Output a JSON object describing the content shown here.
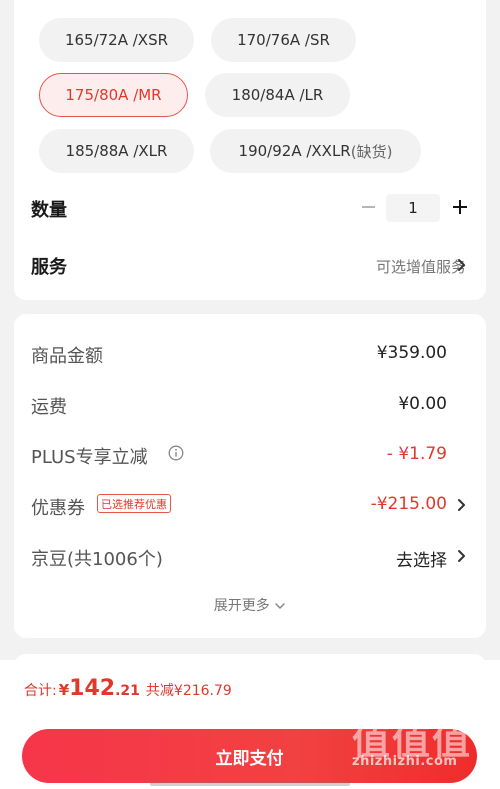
{
  "sizes": [
    {
      "label": "165/72A /XSR",
      "suffix": "",
      "selected": false
    },
    {
      "label": "170/76A /SR",
      "suffix": "",
      "selected": false
    },
    {
      "label": "175/80A /MR",
      "suffix": "",
      "selected": true
    },
    {
      "label": "180/84A /LR",
      "suffix": "",
      "selected": false
    },
    {
      "label": "185/88A /XLR",
      "suffix": "",
      "selected": false
    },
    {
      "label": "190/92A /XXLR",
      "suffix": "(缺货)",
      "selected": false
    }
  ],
  "quantity": {
    "label": "数量",
    "value": "1"
  },
  "service": {
    "label": "服务",
    "link_text": "可选增值服务"
  },
  "prices": {
    "goods_amount_label": "商品金额",
    "goods_amount_value": "¥359.00",
    "shipping_label": "运费",
    "shipping_value": "¥0.00",
    "plus_label": "PLUS专享立减",
    "plus_value": "- ¥1.79",
    "coupon_label": "优惠券",
    "coupon_tag": "已选推荐优惠",
    "coupon_value": "-¥215.00",
    "jingdou_label": "京豆(共1006个)",
    "jingdou_action": "去选择",
    "expand_more": "展开更多"
  },
  "summary": {
    "total_label": "合计:",
    "currency": "¥",
    "total_int": "142",
    "total_dec": ".21",
    "discount_text": "共减¥216.79"
  },
  "pay_button_label": "立即支付",
  "watermark": {
    "logo": "值值值",
    "url": "zhizhizhi.com"
  },
  "colors": {
    "accent": "#e2382c",
    "pay_button": "#f23d40",
    "selected_chip_bg": "#fdeeed"
  }
}
